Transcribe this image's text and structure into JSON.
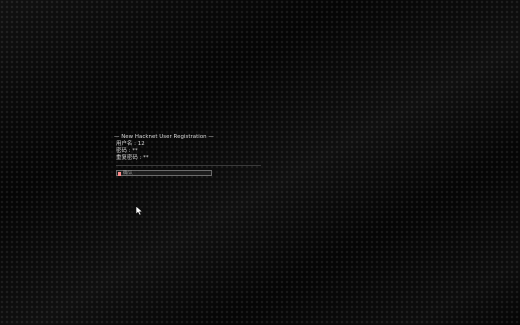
{
  "terminal": {
    "title": "— New Hacknet User Registration —",
    "username_label": "用户名",
    "username_value": "12",
    "password_label": "密码",
    "password_value": "**",
    "confirm_label": "重复密码",
    "confirm_value": "**",
    "input_placeholder": "确认"
  },
  "colors": {
    "background": "#050505",
    "text": "#d8d8d8",
    "cursor": "#ff8b8b"
  },
  "icons": {
    "mouse": "mouse-pointer-icon"
  }
}
